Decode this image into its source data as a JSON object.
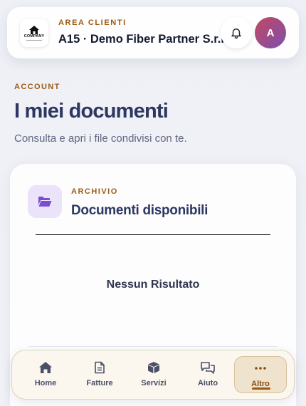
{
  "header": {
    "logo_text": "COMPANY",
    "eyebrow": "AREA CLIENTI",
    "company_name": "A15 · Demo Fiber Partner S.r.l.",
    "avatar_initial": "A",
    "icons": {
      "bell": "bell-icon",
      "logo": "company-logo-icon"
    }
  },
  "page": {
    "section_label": "ACCOUNT",
    "title": "I miei documenti",
    "subtitle": "Consulta e apri i file condivisi con te."
  },
  "card": {
    "eyebrow": "ARCHIVIO",
    "title": "Documenti disponibili",
    "empty_message": "Nessun Risultato",
    "icon": "folder-open-icon"
  },
  "nav": {
    "items": [
      {
        "label": "Home",
        "icon": "home-icon",
        "active": false
      },
      {
        "label": "Fatture",
        "icon": "document-icon",
        "active": false
      },
      {
        "label": "Servizi",
        "icon": "box-icon",
        "active": false
      },
      {
        "label": "Aiuto",
        "icon": "chat-icon",
        "active": false
      },
      {
        "label": "Altro",
        "icon": "more-icon",
        "active": true
      }
    ]
  },
  "colors": {
    "accent": "#9a5a12",
    "title": "#2d3761",
    "avatar_gradient_start": "#c2485f",
    "avatar_gradient_end": "#7d4fb0",
    "folder_tile": "#ebe3fa",
    "folder_icon": "#7b4ed0"
  }
}
